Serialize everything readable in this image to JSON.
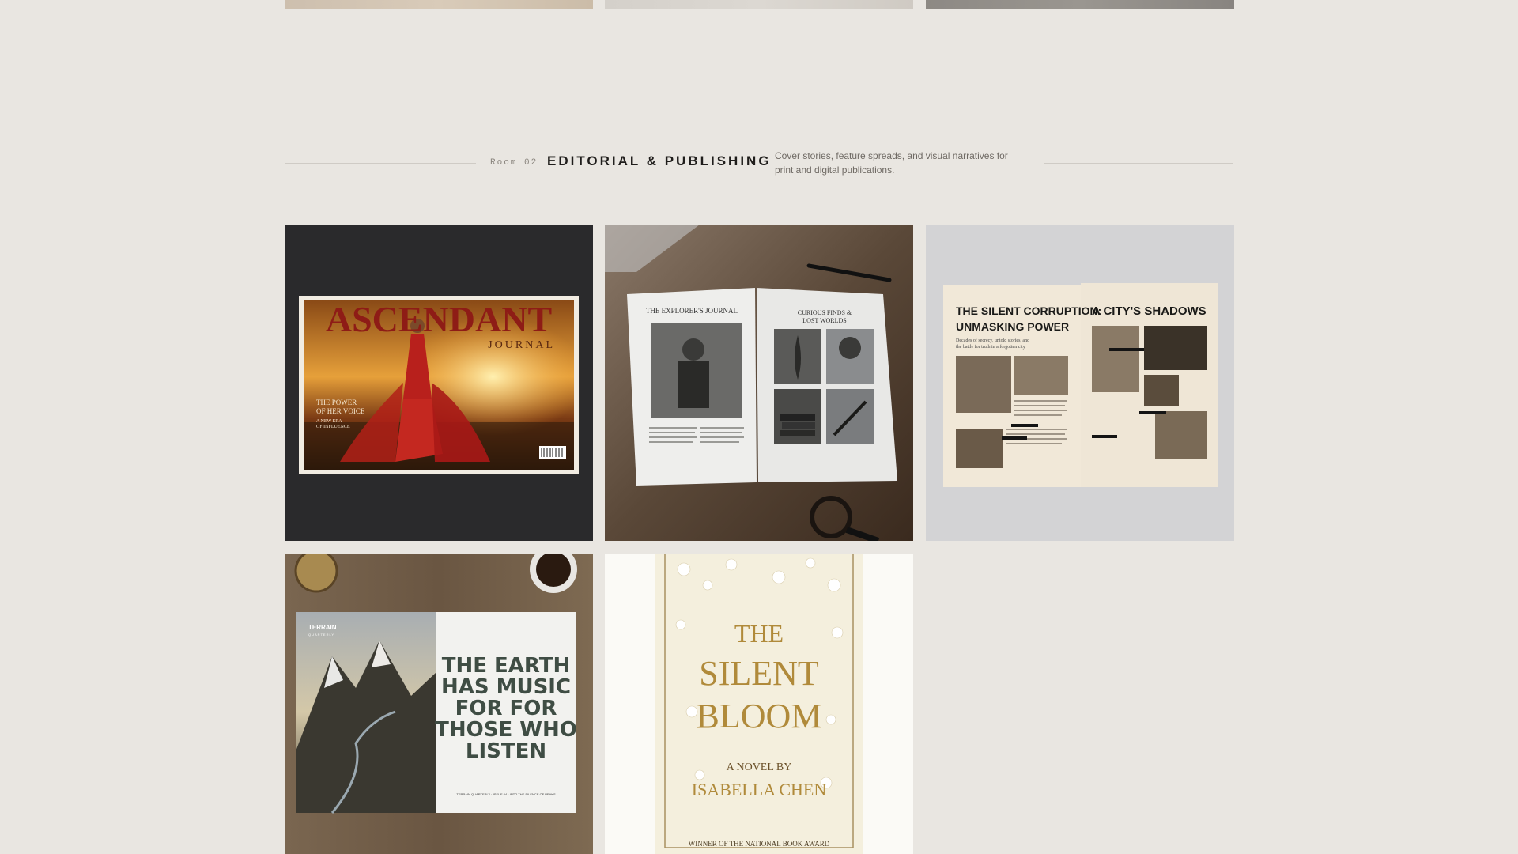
{
  "section": {
    "room": "Room 02",
    "title": "EDITORIAL & PUBLISHING",
    "description": "Cover stories, feature spreads, and visual narratives for print and digital publications."
  },
  "works": [
    {
      "masthead": "ASCENDANT",
      "masthead_sub": "JOURNAL",
      "cover_line_1": "THE POWER",
      "cover_line_2": "OF HER VOICE",
      "cover_line_3": "A NEW ERA",
      "cover_line_4": "OF INFLUENCE"
    },
    {
      "left_heading": "THE EXPLORER'S JOURNAL",
      "right_heading_1": "CURIOUS FINDS &",
      "right_heading_2": "LOST WORLDS"
    },
    {
      "left_heading_1": "THE SILENT CORRUPTION:",
      "left_heading_2": "UNMASKING POWER",
      "left_deck_1": "Decades of secrecy, untold stories, and",
      "left_deck_2": "the battle for truth in a forgotten city",
      "right_heading": "A CITY'S SHADOWS"
    },
    {
      "brand": "TERRAIN",
      "brand_sub": "QUARTERLY",
      "quote_1": "THE EARTH",
      "quote_2": "HAS MUSIC",
      "quote_3": "FOR FOR",
      "quote_4": "THOSE WHO",
      "quote_5": "LISTEN",
      "footer": "TERRAIN QUARTERLY · ISSUE 04 · INTO THE SILENCE OF PEAKS"
    },
    {
      "title_1": "THE",
      "title_2": "SILENT",
      "title_3": "BLOOM",
      "byline": "A NOVEL BY",
      "author": "ISABELLA CHEN",
      "award": "WINNER OF THE NATIONAL BOOK AWARD"
    }
  ]
}
